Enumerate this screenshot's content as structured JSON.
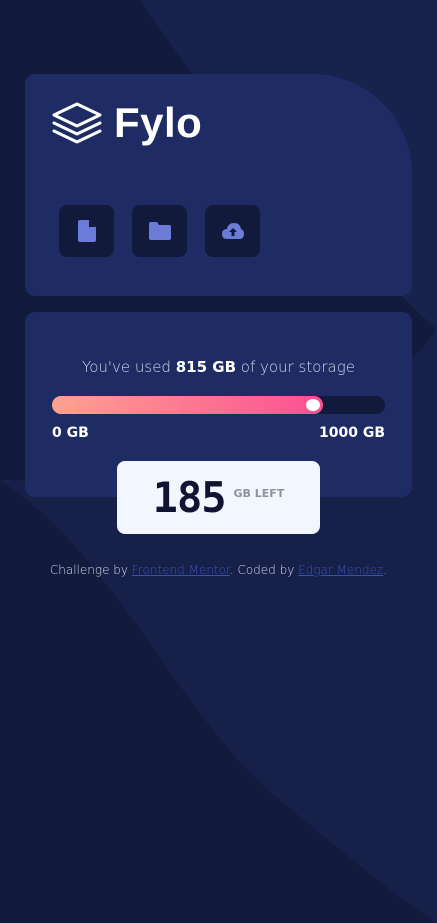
{
  "logo": {
    "text": "Fylo"
  },
  "toolbar": {
    "buttons": [
      {
        "icon": "document-icon"
      },
      {
        "icon": "folder-icon"
      },
      {
        "icon": "upload-cloud-icon"
      }
    ]
  },
  "storage": {
    "text_before": "You've used ",
    "used_amount": "815 GB",
    "text_after": " of your storage",
    "min_label": "0 GB",
    "max_label": "1000 GB",
    "used_fraction": 0.815,
    "left_value": "185",
    "left_unit": "GB LEFT"
  },
  "attribution": {
    "prefix": "Challenge by ",
    "link1": "Frontend Mentor",
    "middle": ". Coded by ",
    "link2": "Edgar Mendez",
    "suffix": "."
  },
  "colors": {
    "background": "#121b3d",
    "card": "#1f2b63",
    "button_bg": "#111a3b",
    "icon": "#6c7bd8",
    "gradient_start": "#fda28f",
    "gradient_end": "#fc4f93",
    "link": "#3b4fb6"
  }
}
